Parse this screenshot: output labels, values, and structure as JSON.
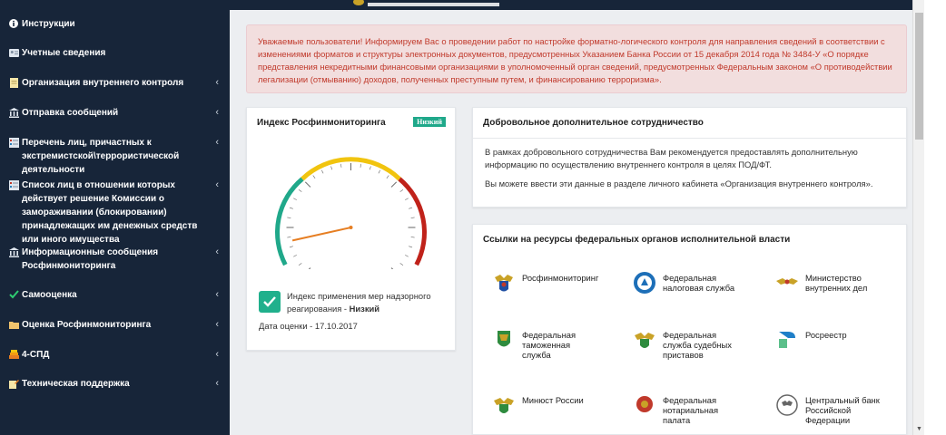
{
  "sidebar": {
    "items": [
      {
        "label": "Инструкции",
        "icon": "info-icon"
      },
      {
        "label": "Учетные сведения",
        "icon": "id-card-icon"
      },
      {
        "label": "Организация внутреннего контроля",
        "icon": "document-icon"
      },
      {
        "label": "Отправка сообщений",
        "icon": "bank-icon"
      },
      {
        "label": "Перечень лиц, причастных к экстремистской\\террористической деятельности",
        "icon": "list-icon"
      },
      {
        "label": "Список лиц в отношении которых действует решение Комиссии о замораживании (блокировании) принадлежащих им денежных средств или иного имущества",
        "icon": "list-icon"
      },
      {
        "label": "Информационные сообщения Росфинмониторинга",
        "icon": "bank-icon"
      },
      {
        "label": "Самооценка",
        "icon": "check-icon"
      },
      {
        "label": "Оценка Росфинмониторинга",
        "icon": "folder-icon"
      },
      {
        "label": "4-СПД",
        "icon": "stack-icon"
      },
      {
        "label": "Техническая поддержка",
        "icon": "edit-icon"
      }
    ]
  },
  "alert": {
    "text": "Уважаемые пользователи! Информируем Вас о проведении работ по настройке форматно-логического контроля для направления сведений в соответствии с изменениями форматов и структуры электронных документов, предусмотренных Указанием Банка России от 15 декабря 2014 года № 3484-У «О порядке представления некредитными финансовыми организациями в уполномоченный орган сведений, предусмотренных Федеральным законом «О противодействии легализации (отмыванию) доходов, полученных преступным путем, и финансированию терроризма»."
  },
  "index_panel": {
    "title": "Индекс Росфинмониторинга",
    "badge": "Низкий",
    "gauge_level": 0.12,
    "check_text": "Индекс применения мер надзорного реагирования - ",
    "check_value": "Низкий",
    "date_text": "Дата оценки - 17.10.2017"
  },
  "coop_panel": {
    "title": "Добровольное дополнительное сотрудничество",
    "p1": "В рамках добровольного сотрудничества Вам рекомендуется предоставлять дополнительную информацию по осуществлению внутреннего контроля в целях ПОД/ФТ.",
    "p2": "Вы можете ввести эти данные в разделе личного кабинета «Организация внутреннего контроля»."
  },
  "links_panel": {
    "title": "Ссылки на ресурсы федеральных органов исполнительной власти",
    "items": [
      {
        "label": "Росфинмониторинг",
        "icon": "rosfinmonitoring-emblem-icon"
      },
      {
        "label": "Федеральная налоговая служба",
        "icon": "tax-service-emblem-icon"
      },
      {
        "label": "Министерство внутренних дел",
        "icon": "mvd-emblem-icon"
      },
      {
        "label": "Федеральная таможенная служба",
        "icon": "customs-emblem-icon"
      },
      {
        "label": "Федеральная служба судебных приставов",
        "icon": "bailiffs-emblem-icon"
      },
      {
        "label": "Росреестр",
        "icon": "rosreestr-logo-icon"
      },
      {
        "label": "Минюст России",
        "icon": "minjust-emblem-icon"
      },
      {
        "label": "Федеральная нотариальная палата",
        "icon": "notary-emblem-icon"
      },
      {
        "label": "Центральный банк Российской Федерации",
        "icon": "central-bank-emblem-icon"
      }
    ]
  },
  "colors": {
    "sidebar_bg": "#172539",
    "alert_text": "#c0392b",
    "gauge_green": "#20a88a",
    "gauge_yellow": "#f1c40f",
    "gauge_red": "#c0221a",
    "needle": "#e67e22"
  }
}
